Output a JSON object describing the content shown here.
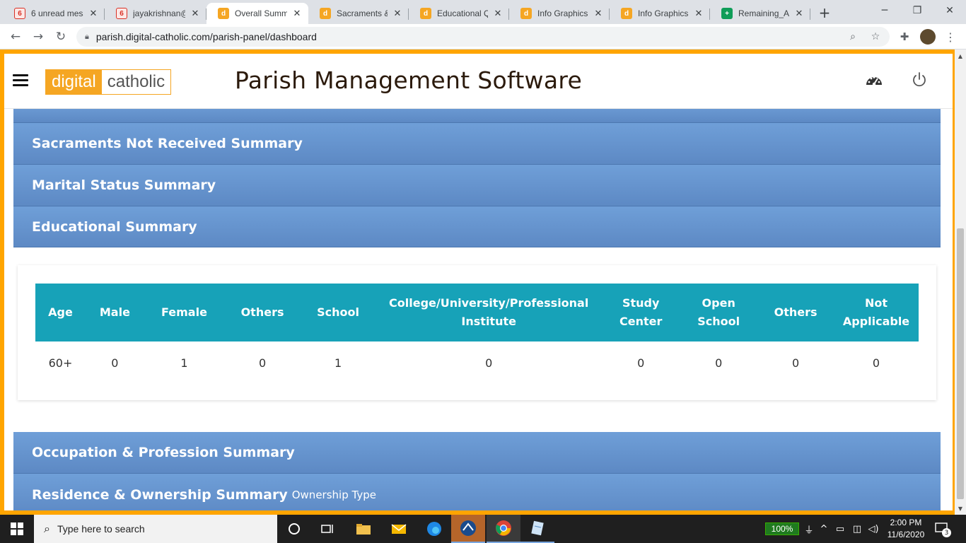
{
  "browser": {
    "tabs": [
      {
        "title": "6 unread mess",
        "favicon": "gmail-icon",
        "badge": "6"
      },
      {
        "title": "jayakrishnan@",
        "favicon": "gmail-icon",
        "badge": "6"
      },
      {
        "title": "Overall Summ",
        "favicon": "digital-catholic-icon",
        "badge": "d"
      },
      {
        "title": "Sacraments &",
        "favicon": "digital-catholic-icon",
        "badge": "d"
      },
      {
        "title": "Educational Qu",
        "favicon": "digital-catholic-icon",
        "badge": "d"
      },
      {
        "title": "Info Graphics -",
        "favicon": "digital-catholic-icon",
        "badge": "d"
      },
      {
        "title": "Info Graphics -",
        "favicon": "digital-catholic-icon",
        "badge": "d"
      },
      {
        "title": "Remaining_AC",
        "favicon": "sheets-icon",
        "badge": "+"
      }
    ],
    "active_tab_index": 2,
    "url": "parish.digital-catholic.com/parish-panel/dashboard"
  },
  "app": {
    "logo_left": "digital",
    "logo_right": "catholic",
    "title": "Parish Management Software"
  },
  "panels": {
    "sacraments": "Sacraments Not Received Summary",
    "marital": "Marital Status Summary",
    "educational": "Educational Summary",
    "occupation": "Occupation & Profession Summary",
    "residence": "Residence & Ownership Summary",
    "residence_sub": "Ownership Type"
  },
  "edu_table": {
    "headers": [
      "Age",
      "Male",
      "Female",
      "Others",
      "School",
      "College/University/Professional Institute",
      "Study Center",
      "Open School",
      "Others",
      "Not Applicable"
    ],
    "rows": [
      [
        "60+",
        "0",
        "1",
        "0",
        "1",
        "0",
        "0",
        "0",
        "0",
        "0"
      ]
    ]
  },
  "taskbar": {
    "search_placeholder": "Type here to search",
    "battery": "100%",
    "time": "2:00 PM",
    "date": "11/6/2020",
    "notifications": "3"
  },
  "colors": {
    "accent_orange": "#ffa500",
    "panel_blue": "#6f9fd8",
    "table_header_teal": "#17a2b8"
  }
}
